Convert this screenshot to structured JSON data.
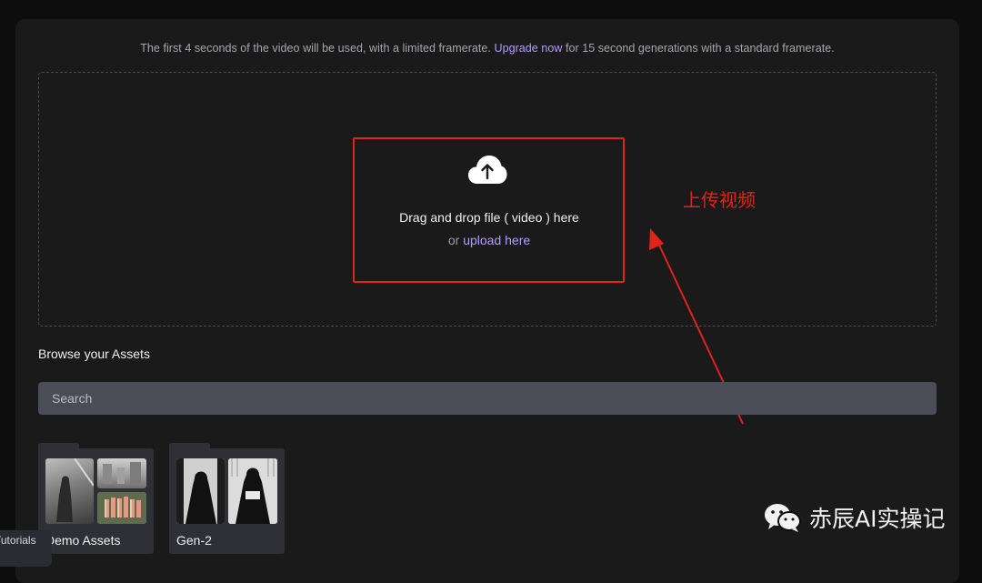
{
  "notice": {
    "prefix": "The first 4 seconds of the video will be used, with a limited framerate.",
    "link": "Upgrade now",
    "suffix": "for 15 second generations with a standard framerate."
  },
  "upload": {
    "icon": "cloud-upload-icon",
    "drag_text": "Drag and drop file ( video ) here",
    "or_text": "or",
    "link_text": "upload here"
  },
  "annotation": {
    "text": "上传视频",
    "color": "#e0231b"
  },
  "browse": {
    "title": "Browse your Assets",
    "search_placeholder": "Search"
  },
  "folders": [
    {
      "name": "Demo Assets"
    },
    {
      "name": "Gen-2"
    }
  ],
  "tutorials": {
    "label": "Tutorials"
  },
  "watermark": {
    "icon": "wechat-icon",
    "text": "赤辰AI实操记"
  },
  "colors": {
    "accent": "#b39cff",
    "background": "#1a1a1a",
    "search_bg": "#4a4d57"
  }
}
